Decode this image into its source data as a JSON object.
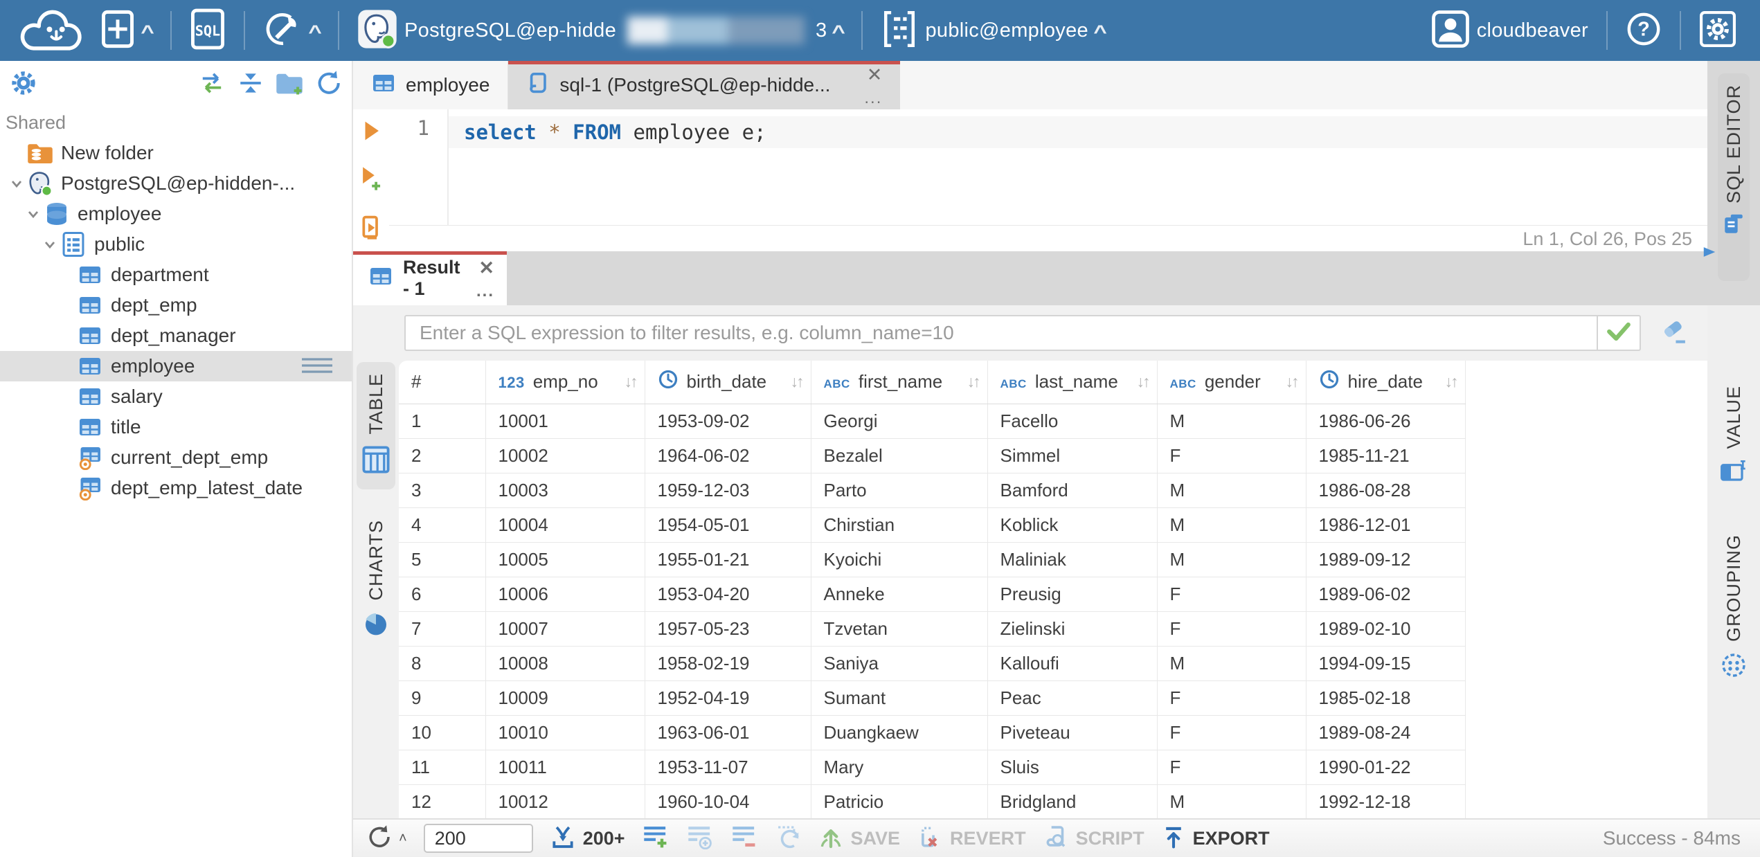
{
  "topbar": {
    "connection": {
      "label": "PostgreSQL@ep-hidde",
      "suffix": "3"
    },
    "schema_selector": {
      "label": "public@employee"
    },
    "user": {
      "name": "cloudbeaver"
    }
  },
  "sidebar": {
    "section_label": "Shared",
    "tree": [
      {
        "label": "New folder",
        "icon": "folder-db",
        "depth": 0,
        "chevron": false
      },
      {
        "label": "PostgreSQL@ep-hidden-...",
        "icon": "postgres",
        "depth": 0,
        "chevron": true
      },
      {
        "label": "employee",
        "icon": "database",
        "depth": 1,
        "chevron": true
      },
      {
        "label": "public",
        "icon": "schema",
        "depth": 2,
        "chevron": true
      },
      {
        "label": "department",
        "icon": "table",
        "depth": 3,
        "chevron": false
      },
      {
        "label": "dept_emp",
        "icon": "table",
        "depth": 3,
        "chevron": false
      },
      {
        "label": "dept_manager",
        "icon": "table",
        "depth": 3,
        "chevron": false
      },
      {
        "label": "employee",
        "icon": "table",
        "depth": 3,
        "chevron": false,
        "selected": true
      },
      {
        "label": "salary",
        "icon": "table",
        "depth": 3,
        "chevron": false
      },
      {
        "label": "title",
        "icon": "table",
        "depth": 3,
        "chevron": false
      },
      {
        "label": "current_dept_emp",
        "icon": "view",
        "depth": 3,
        "chevron": false
      },
      {
        "label": "dept_emp_latest_date",
        "icon": "view",
        "depth": 3,
        "chevron": false
      }
    ]
  },
  "doc_tabs": [
    {
      "label": "employee",
      "icon": "table",
      "active": false
    },
    {
      "label": "sql-1 (PostgreSQL@ep-hidde...",
      "icon": "script",
      "active": true
    }
  ],
  "editor": {
    "line_number": "1",
    "code_tokens": [
      {
        "t": "select",
        "c": "kw"
      },
      {
        "t": " ",
        "c": "id"
      },
      {
        "t": "*",
        "c": "op"
      },
      {
        "t": " ",
        "c": "id"
      },
      {
        "t": "FROM",
        "c": "kw"
      },
      {
        "t": " ",
        "c": "id"
      },
      {
        "t": "employee",
        "c": "id"
      },
      {
        "t": " ",
        "c": "id"
      },
      {
        "t": "e;",
        "c": "id"
      }
    ],
    "status": "Ln 1, Col 26, Pos 25",
    "side_tab": "SQL EDITOR"
  },
  "results": {
    "tab_label": "Result - 1",
    "filter_placeholder": "Enter a SQL expression to filter results, e.g. column_name=10",
    "left_tabs": [
      {
        "label": "TABLE",
        "active": true
      },
      {
        "label": "CHARTS",
        "active": false
      }
    ],
    "right_tabs": [
      {
        "label": "VALUE"
      },
      {
        "label": "GROUPING"
      }
    ],
    "grid": {
      "columns": [
        {
          "name": "#",
          "type": null
        },
        {
          "name": "emp_no",
          "type": "numeric"
        },
        {
          "name": "birth_date",
          "type": "datetime"
        },
        {
          "name": "first_name",
          "type": "string"
        },
        {
          "name": "last_name",
          "type": "string"
        },
        {
          "name": "gender",
          "type": "string"
        },
        {
          "name": "hire_date",
          "type": "datetime"
        }
      ],
      "rows": [
        [
          "1",
          "10001",
          "1953-09-02",
          "Georgi",
          "Facello",
          "M",
          "1986-06-26"
        ],
        [
          "2",
          "10002",
          "1964-06-02",
          "Bezalel",
          "Simmel",
          "F",
          "1985-11-21"
        ],
        [
          "3",
          "10003",
          "1959-12-03",
          "Parto",
          "Bamford",
          "M",
          "1986-08-28"
        ],
        [
          "4",
          "10004",
          "1954-05-01",
          "Chirstian",
          "Koblick",
          "M",
          "1986-12-01"
        ],
        [
          "5",
          "10005",
          "1955-01-21",
          "Kyoichi",
          "Maliniak",
          "M",
          "1989-09-12"
        ],
        [
          "6",
          "10006",
          "1953-04-20",
          "Anneke",
          "Preusig",
          "F",
          "1989-06-02"
        ],
        [
          "7",
          "10007",
          "1957-05-23",
          "Tzvetan",
          "Zielinski",
          "F",
          "1989-02-10"
        ],
        [
          "8",
          "10008",
          "1958-02-19",
          "Saniya",
          "Kalloufi",
          "M",
          "1994-09-15"
        ],
        [
          "9",
          "10009",
          "1952-04-19",
          "Sumant",
          "Peac",
          "F",
          "1985-02-18"
        ],
        [
          "10",
          "10010",
          "1963-06-01",
          "Duangkaew",
          "Piveteau",
          "F",
          "1989-08-24"
        ],
        [
          "11",
          "10011",
          "1953-11-07",
          "Mary",
          "Sluis",
          "F",
          "1990-01-22"
        ],
        [
          "12",
          "10012",
          "1960-10-04",
          "Patricio",
          "Bridgland",
          "M",
          "1992-12-18"
        ]
      ]
    }
  },
  "toolbar": {
    "row_limit_value": "200",
    "fetch_label": "200+",
    "save_label": "SAVE",
    "revert_label": "REVERT",
    "script_label": "SCRIPT",
    "export_label": "EXPORT",
    "status": "Success - 84ms"
  }
}
